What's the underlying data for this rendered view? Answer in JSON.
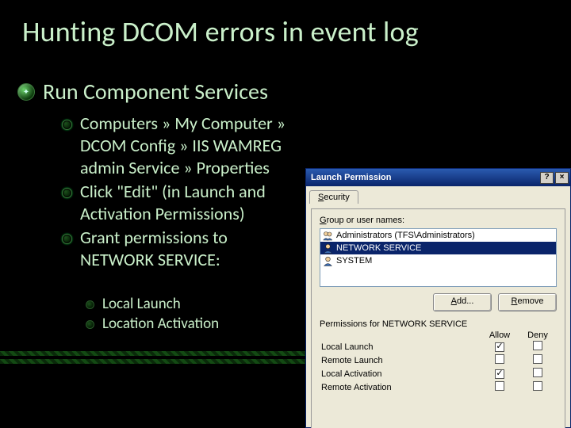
{
  "title": "Hunting DCOM errors in event log",
  "main": {
    "label": "Run Component Services",
    "icon": "services-icon"
  },
  "sub": [
    "Computers » My Computer » DCOM Config » IIS WAMREG admin Service » Properties",
    "Click \"Edit\" (in Launch and Activation Permissions)",
    "Grant permissions to NETWORK SERVICE:"
  ],
  "subsub": [
    "Local Launch",
    "Location Activation"
  ],
  "dialog": {
    "title": "Launch Permission",
    "help_btn": "?",
    "close_btn": "×",
    "tab": "Security",
    "group_label": "Group or user names:",
    "users": [
      {
        "name": "Administrators (TFS\\Administrators)",
        "icon": "group-icon",
        "selected": false
      },
      {
        "name": "NETWORK SERVICE",
        "icon": "user-icon",
        "selected": true
      },
      {
        "name": "SYSTEM",
        "icon": "user-icon",
        "selected": false
      }
    ],
    "add_btn": "Add...",
    "remove_btn": "Remove",
    "perm_for": "Permissions for NETWORK SERVICE",
    "cols": {
      "allow": "Allow",
      "deny": "Deny"
    },
    "perms": [
      {
        "name": "Local Launch",
        "allow": true,
        "deny": false
      },
      {
        "name": "Remote Launch",
        "allow": false,
        "deny": false
      },
      {
        "name": "Local Activation",
        "allow": true,
        "deny": false
      },
      {
        "name": "Remote Activation",
        "allow": false,
        "deny": false
      }
    ]
  }
}
